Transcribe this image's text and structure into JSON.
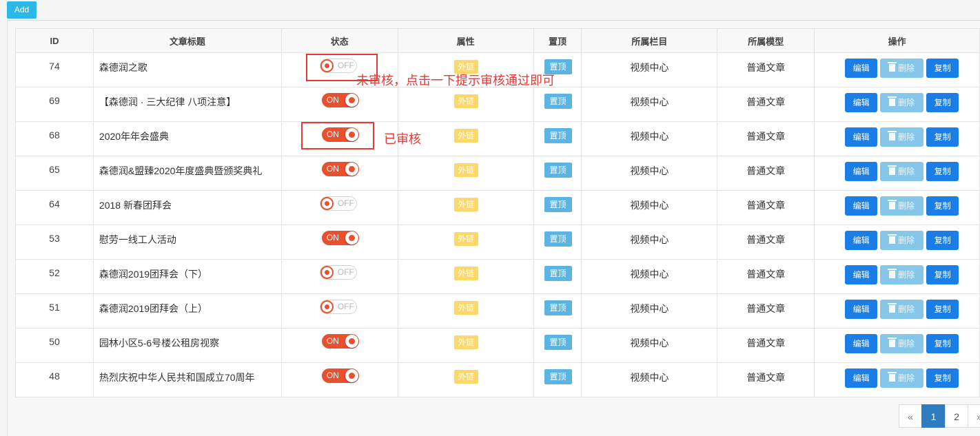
{
  "toolbar": {
    "add_label": "Add"
  },
  "columns": [
    "ID",
    "文章标题",
    "状态",
    "属性",
    "置顶",
    "所属栏目",
    "所属模型",
    "操作"
  ],
  "rows": [
    {
      "id": "74",
      "title": "森德润之歌",
      "status": "OFF",
      "attr": "外链",
      "top": "置顶",
      "category": "视频中心",
      "model": "普通文章"
    },
    {
      "id": "69",
      "title": "【森德润 · 三大纪律 八项注意】",
      "status": "ON",
      "attr": "外链",
      "top": "置顶",
      "category": "视频中心",
      "model": "普通文章"
    },
    {
      "id": "68",
      "title": "2020年年会盛典",
      "status": "ON",
      "attr": "外链",
      "top": "置顶",
      "category": "视频中心",
      "model": "普通文章"
    },
    {
      "id": "65",
      "title": "森德润&盟臻2020年度盛典暨颁奖典礼",
      "status": "ON",
      "attr": "外链",
      "top": "置顶",
      "category": "视频中心",
      "model": "普通文章"
    },
    {
      "id": "64",
      "title": "2018 新春团拜会",
      "status": "OFF",
      "attr": "外链",
      "top": "置顶",
      "category": "视频中心",
      "model": "普通文章"
    },
    {
      "id": "53",
      "title": "慰劳一线工人活动",
      "status": "ON",
      "attr": "外链",
      "top": "置顶",
      "category": "视频中心",
      "model": "普通文章"
    },
    {
      "id": "52",
      "title": "森德润2019团拜会（下）",
      "status": "OFF",
      "attr": "外链",
      "top": "置顶",
      "category": "视频中心",
      "model": "普通文章"
    },
    {
      "id": "51",
      "title": "森德润2019团拜会（上）",
      "status": "OFF",
      "attr": "外链",
      "top": "置顶",
      "category": "视频中心",
      "model": "普通文章"
    },
    {
      "id": "50",
      "title": "园林小区5-6号楼公租房视察",
      "status": "ON",
      "attr": "外链",
      "top": "置顶",
      "category": "视频中心",
      "model": "普通文章"
    },
    {
      "id": "48",
      "title": "热烈庆祝中华人民共和国成立70周年",
      "status": "ON",
      "attr": "外链",
      "top": "置顶",
      "category": "视频中心",
      "model": "普通文章"
    }
  ],
  "actions": {
    "edit": "编辑",
    "delete": "删除",
    "copy": "复制"
  },
  "annotations": {
    "unreviewed": "未审核，点击一下提示审核通过即可",
    "reviewed": "已审核"
  },
  "pagination": {
    "prev": "«",
    "pages": [
      "1",
      "2"
    ],
    "current": "1",
    "next": "»"
  },
  "colors": {
    "toggle_on": "#e8502f",
    "attr_badge": "#fcd86a",
    "top_button": "#5bb4e1",
    "primary_button": "#1a7ee6",
    "annotation": "#e53935",
    "add_button": "#2bb8e6"
  }
}
